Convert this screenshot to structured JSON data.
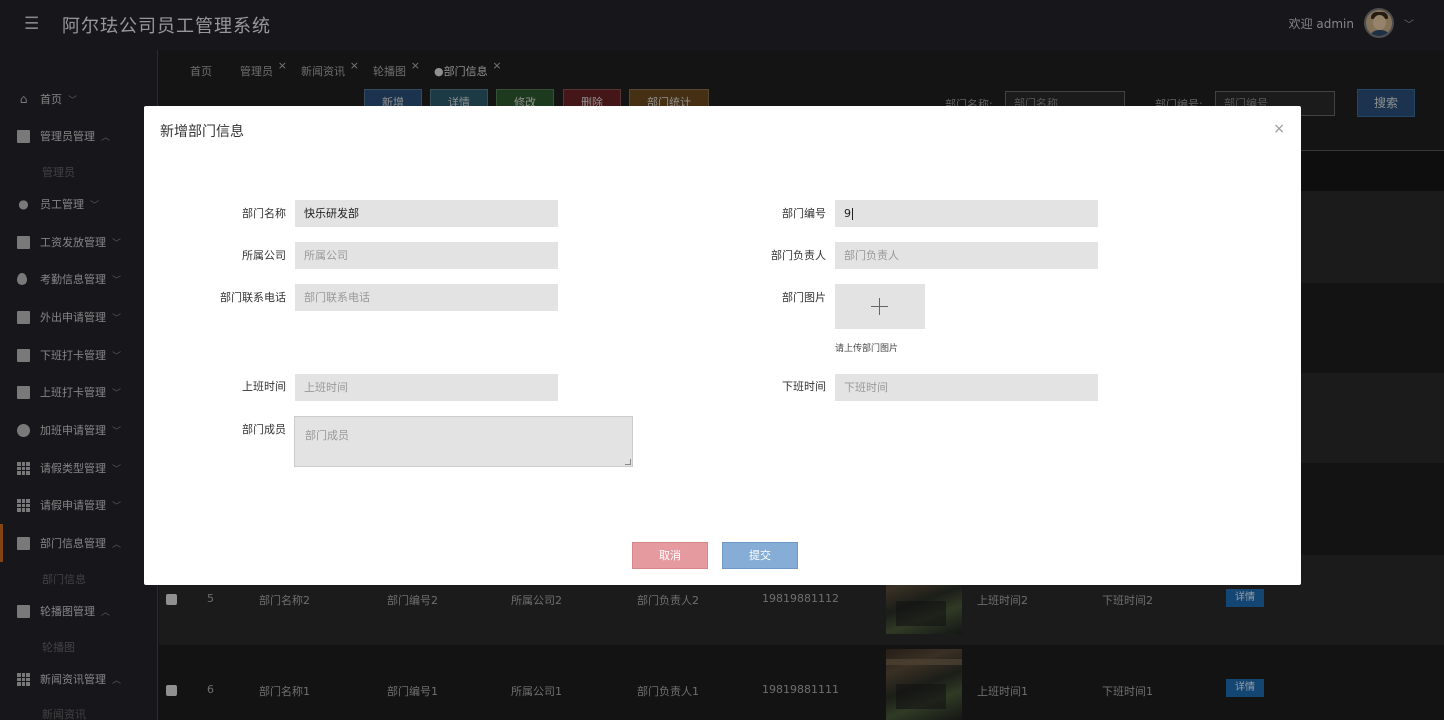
{
  "header": {
    "menu_icon": "hamburger-icon",
    "title": "阿尔珐公司员工管理系统",
    "welcome": "欢迎 admin",
    "caret": "﹀"
  },
  "sidebar": {
    "items": [
      {
        "label": "首页",
        "icon": "home-icon"
      },
      {
        "label": "管理员管理",
        "icon": "building-icon"
      },
      {
        "label": "员工管理",
        "icon": "user-icon"
      },
      {
        "label": "工资发放管理",
        "icon": "book-icon"
      },
      {
        "label": "考勤信息管理",
        "icon": "drop-icon"
      },
      {
        "label": "外出申请管理",
        "icon": "contact-icon"
      },
      {
        "label": "下班打卡管理",
        "icon": "book-icon"
      },
      {
        "label": "上班打卡管理",
        "icon": "chart-icon"
      },
      {
        "label": "加班申请管理",
        "icon": "check-circle-icon"
      },
      {
        "label": "请假类型管理",
        "icon": "grid-icon"
      },
      {
        "label": "请假申请管理",
        "icon": "grid-icon"
      },
      {
        "label": "部门信息管理",
        "icon": "shop-icon"
      },
      {
        "label": "轮播图管理",
        "icon": "image-icon"
      },
      {
        "label": "新闻资讯管理",
        "icon": "apps-icon"
      }
    ],
    "subs": {
      "admin": "管理员",
      "dept": "部门信息",
      "carousel": "轮播图",
      "news": "新闻资讯"
    }
  },
  "tabs": [
    {
      "label": "首页",
      "closable": false
    },
    {
      "label": "管理员",
      "closable": true
    },
    {
      "label": "新闻资讯",
      "closable": true
    },
    {
      "label": "轮播图",
      "closable": true
    },
    {
      "label": "●部门信息",
      "closable": true
    }
  ],
  "toolbar": {
    "add": "新增",
    "detail": "详情",
    "edit": "修改",
    "delete": "删除",
    "stats": "部门统计",
    "colors": {
      "add": "#2a4f78",
      "detail": "#2a5a6a",
      "edit": "#2e5a2e",
      "delete": "#6a2326",
      "stats": "#6a4a1e"
    }
  },
  "search": {
    "name_label": "部门名称:",
    "name_placeholder": "部门名称",
    "code_label": "部门编号:",
    "code_placeholder": "部门编号",
    "button": "搜索"
  },
  "table": {
    "rows": [
      {
        "index": "5",
        "name": "部门名称2",
        "code": "部门编号2",
        "company": "所属公司2",
        "leader": "部门负责人2",
        "phone": "19819881112",
        "start": "上班时间2",
        "end": "下班时间2",
        "action": "详情"
      },
      {
        "index": "6",
        "name": "部门名称1",
        "code": "部门编号1",
        "company": "所属公司1",
        "leader": "部门负责人1",
        "phone": "19819881111",
        "start": "上班时间1",
        "end": "下班时间1",
        "action": "详情"
      }
    ]
  },
  "modal": {
    "title": "新增部门信息",
    "close": "×",
    "fields": {
      "name_label": "部门名称",
      "name_value": "快乐研发部",
      "code_label": "部门编号",
      "code_value": "9",
      "company_label": "所属公司",
      "company_placeholder": "所属公司",
      "leader_label": "部门负责人",
      "leader_placeholder": "部门负责人",
      "phone_label": "部门联系电话",
      "phone_placeholder": "部门联系电话",
      "image_label": "部门图片",
      "upload_hint": "请上传部门图片",
      "start_label": "上班时间",
      "start_placeholder": "上班时间",
      "end_label": "下班时间",
      "end_placeholder": "下班时间",
      "members_label": "部门成员",
      "members_placeholder": "部门成员"
    },
    "cancel": "取消",
    "submit": "提交"
  },
  "colors": {
    "accent": "#c86a1e",
    "cancel": "#e59aa0",
    "submit": "#86add6",
    "detail_btn": "#1f6cb3"
  }
}
